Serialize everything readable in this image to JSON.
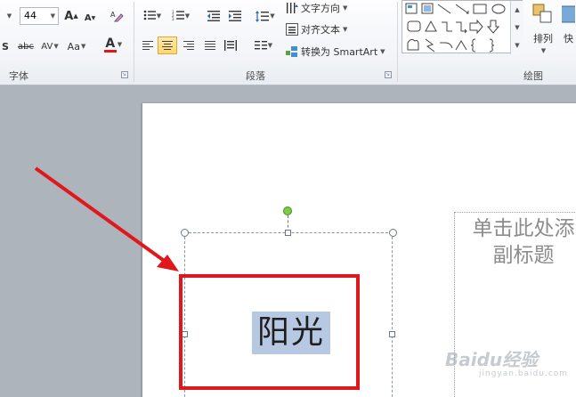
{
  "ribbon": {
    "font_group": {
      "label": "字体",
      "font_size": "44",
      "grow_label": "A",
      "shrink_label": "A",
      "shadow_label": "S",
      "strike_label": "abc",
      "spacing_label": "AV",
      "case_label": "Aa",
      "color_label": "A"
    },
    "paragraph_group": {
      "label": "段落",
      "text_direction_label": "文字方向",
      "align_text_label": "对齐文本",
      "convert_smartart_label": "转换为 SmartArt"
    },
    "drawing_group": {
      "label": "绘图",
      "arrange_label": "排列",
      "quick_label": "快"
    }
  },
  "slide": {
    "title_text": "阳光",
    "subtitle_placeholder": "单击此处添\n副标题"
  },
  "watermark": {
    "brand": "Baidu经验",
    "url": "jingyan.baidu.com"
  },
  "colors": {
    "annotation_red": "#e0181c",
    "selection_highlight": "#b7c9e2",
    "rotate_handle": "#7ccc3e",
    "font_color_underline": "#e0181c"
  }
}
